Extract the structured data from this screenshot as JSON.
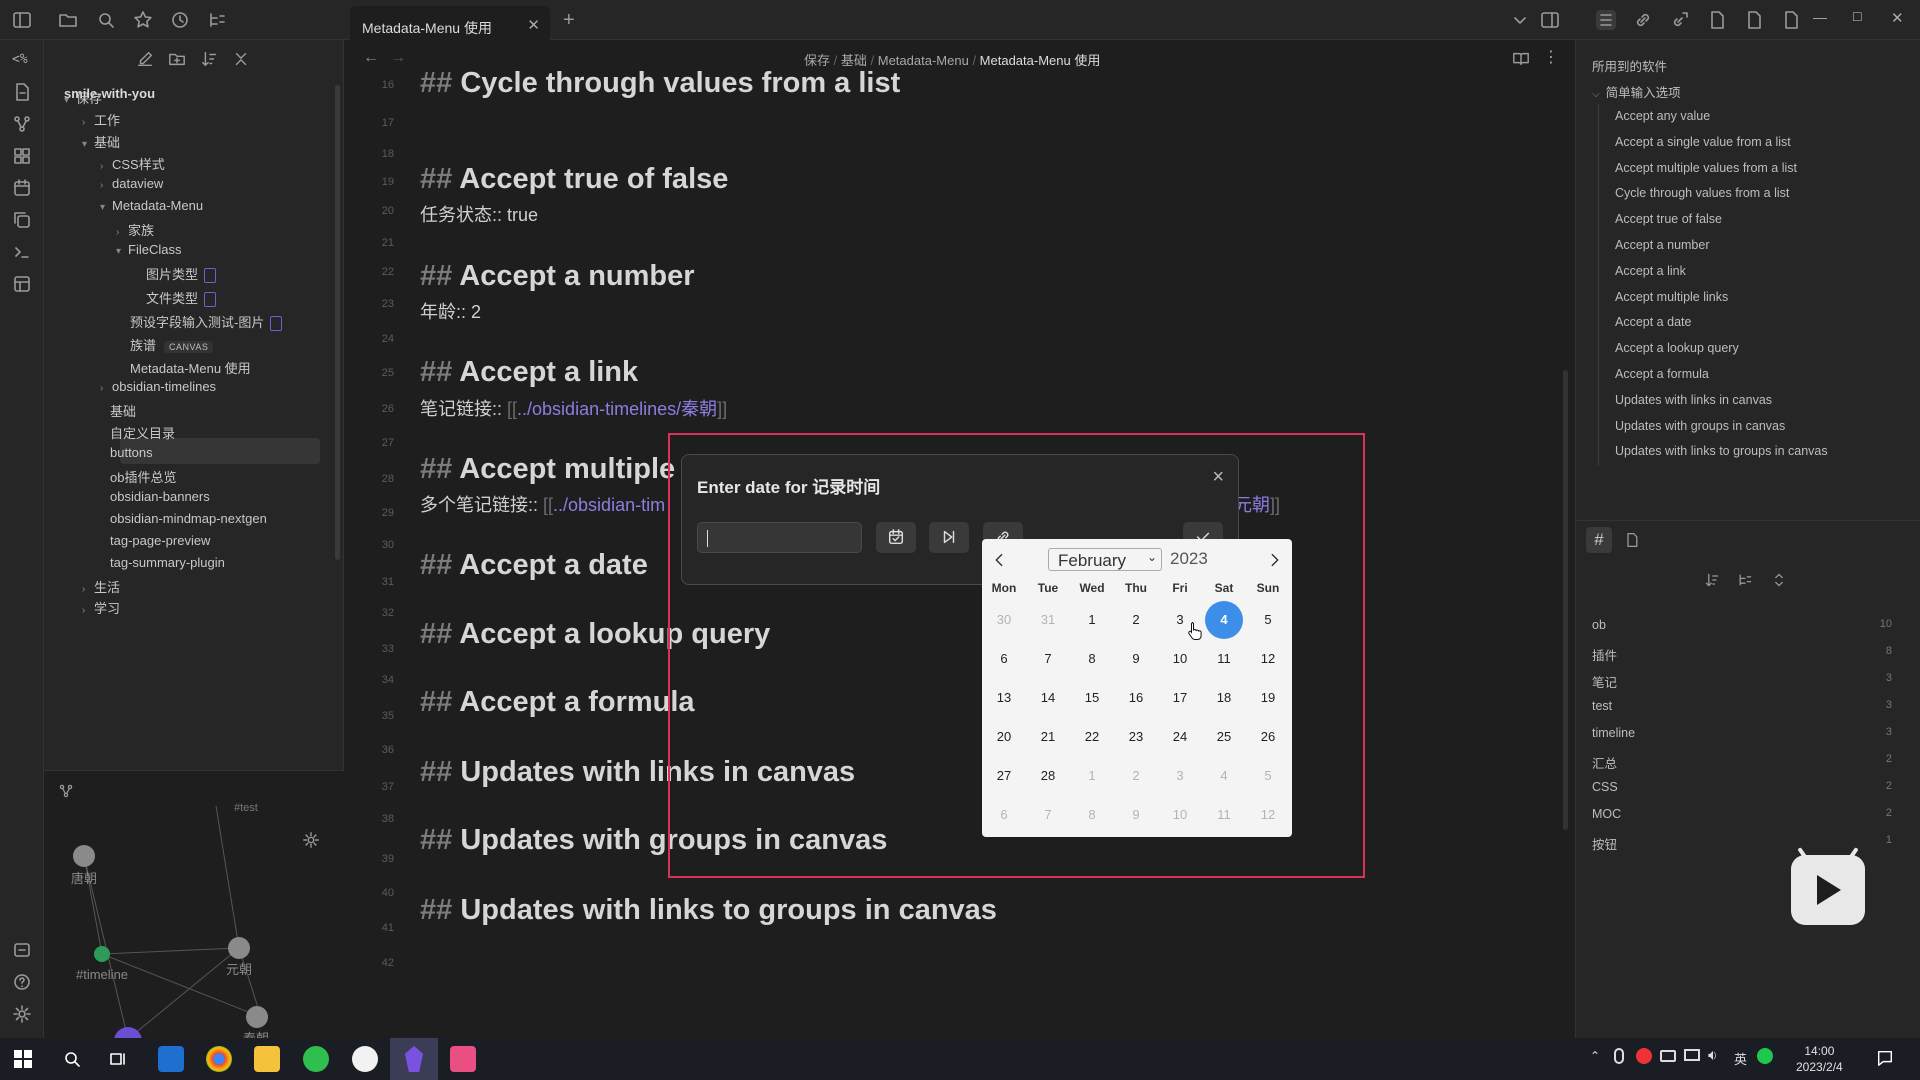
{
  "tab": {
    "title": "Metadata-Menu 使用"
  },
  "breadcrumb": [
    "保存",
    "基础",
    "Metadata-Menu",
    "Metadata-Menu 使用"
  ],
  "sidebar": {
    "vault_name": "smile-with-you",
    "tree": [
      {
        "label": "保存"
      },
      {
        "label": "工作"
      },
      {
        "label": "基础"
      },
      {
        "label": "CSS样式"
      },
      {
        "label": "dataview"
      },
      {
        "label": "Metadata-Menu"
      },
      {
        "label": "家族"
      },
      {
        "label": "FileClass"
      },
      {
        "label": "图片类型"
      },
      {
        "label": "文件类型"
      },
      {
        "label": "预设字段输入测试-图片"
      },
      {
        "label": "族谱",
        "badge": "CANVAS"
      },
      {
        "label": "Metadata-Menu 使用"
      },
      {
        "label": "obsidian-timelines"
      },
      {
        "label": "基础"
      },
      {
        "label": "自定义目录"
      },
      {
        "label": "buttons"
      },
      {
        "label": "ob插件总览"
      },
      {
        "label": "obsidian-banners"
      },
      {
        "label": "obsidian-mindmap-nextgen"
      },
      {
        "label": "tag-page-preview"
      },
      {
        "label": "tag-summary-plugin"
      },
      {
        "label": "生活"
      },
      {
        "label": "学习"
      }
    ]
  },
  "graph": {
    "nodes": [
      "#test",
      "唐朝",
      "元朝",
      "#timeline",
      "秦朝"
    ]
  },
  "editor": {
    "line_numbers": [
      "16",
      "17",
      "18",
      "19",
      "20",
      "21",
      "22",
      "23",
      "24",
      "25",
      "26",
      "27",
      "28",
      "29",
      "30",
      "31",
      "32",
      "33",
      "34",
      "35",
      "36",
      "37",
      "38",
      "39",
      "40",
      "41",
      "42"
    ],
    "heading_marker": "##",
    "headings": [
      "Cycle through values from a list",
      "Accept true of false",
      "Accept a number",
      "Accept a link",
      "Accept multiple",
      "Accept a date",
      "Accept a lookup query",
      "Accept a formula",
      "Updates with links in canvas",
      "Updates with groups in canvas",
      "Updates with links to groups in canvas"
    ],
    "fields": {
      "status": "任务状态:: true",
      "age": "年龄:: 2",
      "link_prefix": "笔记链接:: ",
      "link_open": "[[",
      "link_text": "../obsidian-timelines/秦朝",
      "link_close": "]]",
      "multi_prefix": "多个笔记链接:: ",
      "multi_open": "[[",
      "multi_text": "../obsidian-tim",
      "multi_tail": "元朝",
      "multi_close": "]]"
    }
  },
  "dialog": {
    "title": "Enter date for 记录时间",
    "close": "×",
    "input_value": ""
  },
  "datepicker": {
    "month": "February",
    "year": "2023",
    "weekdays": [
      "Mon",
      "Tue",
      "Wed",
      "Thu",
      "Fri",
      "Sat",
      "Sun"
    ],
    "weeks": [
      [
        "30",
        "31",
        "1",
        "2",
        "3",
        "4",
        "5"
      ],
      [
        "6",
        "7",
        "8",
        "9",
        "10",
        "11",
        "12"
      ],
      [
        "13",
        "14",
        "15",
        "16",
        "17",
        "18",
        "19"
      ],
      [
        "20",
        "21",
        "22",
        "23",
        "24",
        "25",
        "26"
      ],
      [
        "27",
        "28",
        "1",
        "2",
        "3",
        "4",
        "5"
      ],
      [
        "6",
        "7",
        "8",
        "9",
        "10",
        "11",
        "12"
      ]
    ],
    "selected": "4"
  },
  "outline": {
    "root": "所用到的软件",
    "section": "简单输入选项",
    "items": [
      "Accept any value",
      "Accept a single value from a list",
      "Accept multiple values from a list",
      "Cycle through values from a list",
      "Accept true of false",
      "Accept a number",
      "Accept a link",
      "Accept multiple links",
      "Accept a date",
      "Accept a lookup query",
      "Accept a formula",
      "Updates with links in canvas",
      "Updates with groups in canvas",
      "Updates with links to groups in canvas"
    ]
  },
  "tags": [
    {
      "name": "ob",
      "count": "10"
    },
    {
      "name": "插件",
      "count": "8"
    },
    {
      "name": "笔记",
      "count": "3"
    },
    {
      "name": "test",
      "count": "3"
    },
    {
      "name": "timeline",
      "count": "3"
    },
    {
      "name": "汇总",
      "count": "2"
    },
    {
      "name": "CSS",
      "count": "2"
    },
    {
      "name": "MOC",
      "count": "2"
    },
    {
      "name": "按钮",
      "count": "1"
    }
  ],
  "taskbar": {
    "time": "14:00",
    "date": "2023/2/4",
    "ime": "英"
  },
  "colors": {
    "accent": "#8b7ee0",
    "selected_day": "#3d8ee8",
    "highlight_border": "#d8315b"
  }
}
